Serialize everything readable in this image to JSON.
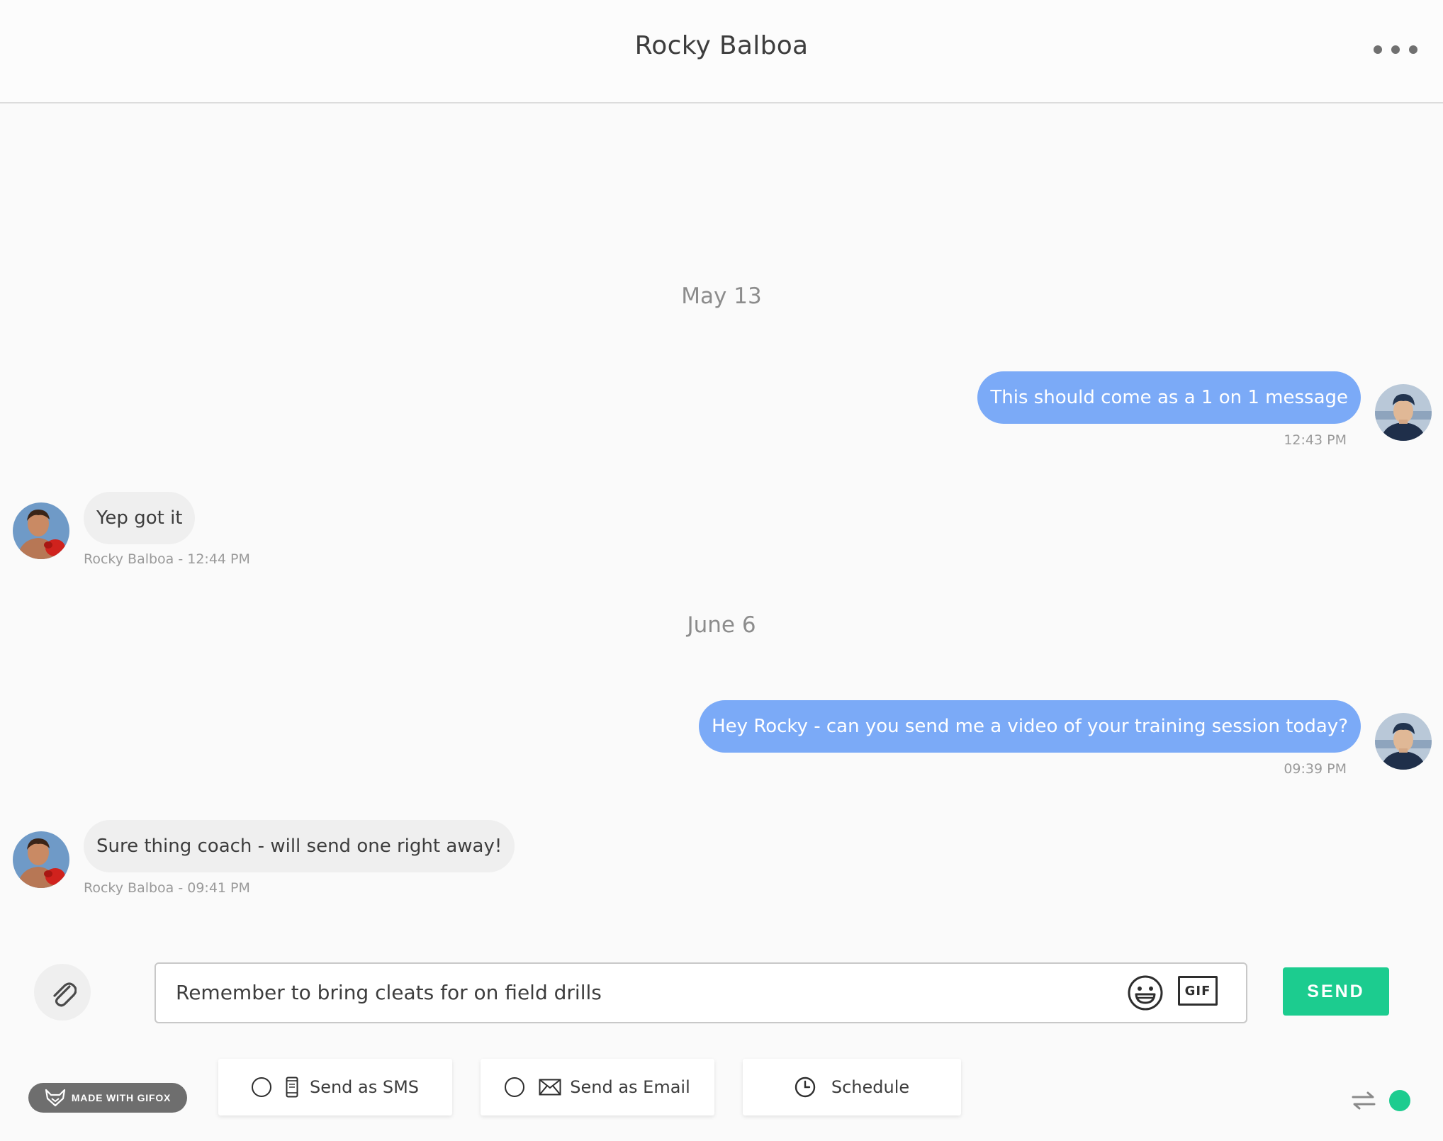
{
  "header": {
    "title": "Rocky Balboa",
    "more_icon": "more-horizontal-icon"
  },
  "conversation": {
    "sections": [
      {
        "date": "May 13",
        "messages": [
          {
            "direction": "outgoing",
            "text": "This should come as a 1 on 1 message",
            "meta": "12:43 PM"
          },
          {
            "direction": "incoming",
            "text": "Yep got it",
            "meta": "Rocky Balboa - 12:44 PM"
          }
        ]
      },
      {
        "date": "June 6",
        "messages": [
          {
            "direction": "outgoing",
            "text": "Hey Rocky - can you send me a video of your training session today?",
            "meta": "09:39 PM"
          },
          {
            "direction": "incoming",
            "text": "Sure thing coach - will send one right away!",
            "meta": "Rocky Balboa - 09:41 PM"
          }
        ]
      }
    ]
  },
  "composer": {
    "attach_icon": "paperclip-icon",
    "input_value": "Remember to bring cleats for on field drills",
    "emoji_icon": "smiley-icon",
    "gif_label": "GIF",
    "send_label": "SEND"
  },
  "options": {
    "sms": {
      "label": "Send as SMS",
      "icon": "phone-icon",
      "checked": false
    },
    "email": {
      "label": "Send as Email",
      "icon": "envelope-icon",
      "checked": false
    },
    "schedule": {
      "label": "Schedule",
      "icon": "clock-icon"
    }
  },
  "badge": {
    "label": "MADE WITH GIFOX"
  },
  "status": {
    "swap_icon": "swap-arrows-icon",
    "online_color": "#1ccc8f"
  },
  "colors": {
    "outgoing_bubble": "#7baaf7",
    "incoming_bubble": "#efefef",
    "accent": "#1ccc8f"
  }
}
